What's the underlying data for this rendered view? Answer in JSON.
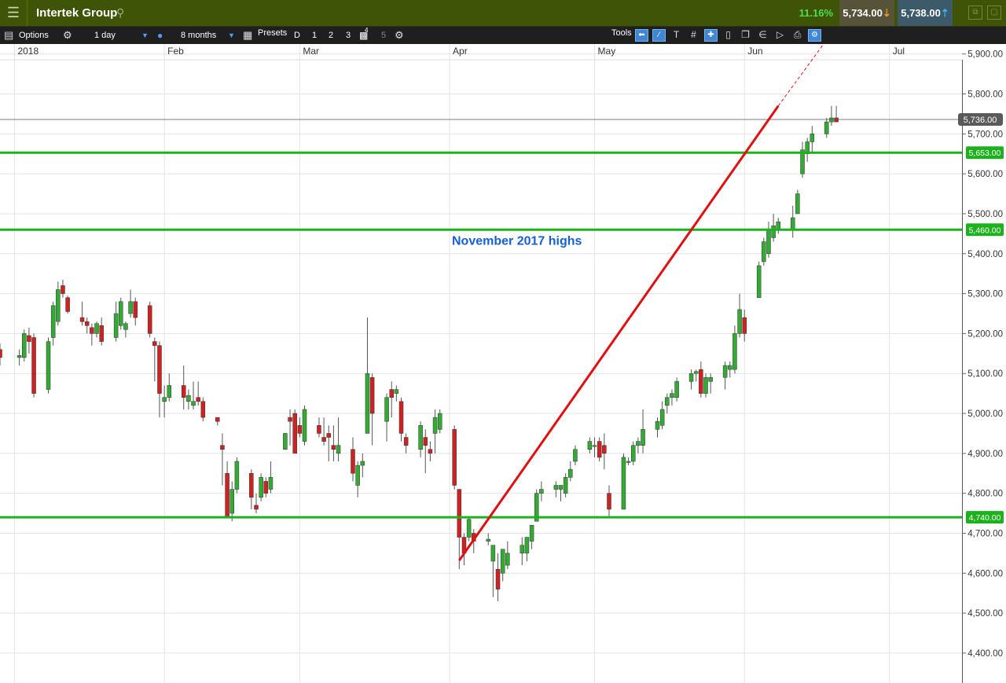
{
  "header": {
    "menu_icon": "menu-icon",
    "instrument": "Intertek Group",
    "search_icon": "search-icon",
    "change_pct": "11.16%",
    "sell_price": "5,734.00",
    "buy_price": "5,738.00"
  },
  "toolbar": {
    "options_label": "Options",
    "interval": "1 day",
    "period": "8 months",
    "presets_label": "Presets",
    "preset_buttons": [
      "D",
      "1",
      "2",
      "3",
      "4",
      "5"
    ],
    "tools_label": "Tools"
  },
  "colors": {
    "up_candle": "#33aa33",
    "down_candle": "#cc2222",
    "level_line": "#1db21d",
    "trend_line": "#e01010",
    "annotation_text": "#1560d6"
  },
  "chart_data": {
    "type": "candlestick",
    "title": "",
    "x_axis": {
      "labels": [
        "2018",
        "Feb",
        "Mar",
        "Apr",
        "May",
        "Jun",
        "Jul"
      ],
      "range": [
        "2017-12-29",
        "2018-07-16"
      ]
    },
    "y_axis": {
      "tick_labels": [
        "4,400.00",
        "4,500.00",
        "4,600.00",
        "4,700.00",
        "4,800.00",
        "4,900.00",
        "5,000.00",
        "5,100.00",
        "5,200.00",
        "5,300.00",
        "5,400.00",
        "5,500.00",
        "5,600.00",
        "5,700.00",
        "5,800.00",
        "5,900.00"
      ],
      "range": [
        4325,
        5925
      ],
      "position": "right"
    },
    "grid": true,
    "current_price": {
      "value": 5736,
      "label": "5,736.00"
    },
    "levels": [
      {
        "value": 5653,
        "label": "5,653.00"
      },
      {
        "value": 5460,
        "label": "5,460.00"
      },
      {
        "value": 4740,
        "label": "4,740.00"
      }
    ],
    "annotations": [
      {
        "text": "November 2017 highs",
        "level": 5460
      }
    ],
    "trend_line": {
      "from": {
        "date": "2018-04-03",
        "price": 4632
      },
      "to": {
        "date": "2018-06-08",
        "price": 5770
      },
      "extended_to": {
        "date": "2018-06-21",
        "price": 5985
      }
    },
    "candles": [
      [
        "2017-12-28",
        5170,
        5210,
        5130,
        5160
      ],
      [
        "2017-12-29",
        5160,
        5175,
        5120,
        5140
      ],
      [
        "2018-01-02",
        5140,
        5160,
        5120,
        5145
      ],
      [
        "2018-01-03",
        5140,
        5210,
        5130,
        5200
      ],
      [
        "2018-01-04",
        5195,
        5215,
        5150,
        5180
      ],
      [
        "2018-01-05",
        5190,
        5200,
        5040,
        5050
      ],
      [
        "2018-01-08",
        5060,
        5190,
        5050,
        5180
      ],
      [
        "2018-01-09",
        5190,
        5280,
        5170,
        5270
      ],
      [
        "2018-01-10",
        5230,
        5330,
        5220,
        5310
      ],
      [
        "2018-01-11",
        5320,
        5335,
        5290,
        5300
      ],
      [
        "2018-01-12",
        5290,
        5295,
        5250,
        5255
      ],
      [
        "2018-01-15",
        5240,
        5280,
        5220,
        5230
      ],
      [
        "2018-01-16",
        5230,
        5240,
        5200,
        5220
      ],
      [
        "2018-01-17",
        5215,
        5225,
        5170,
        5200
      ],
      [
        "2018-01-18",
        5200,
        5230,
        5190,
        5225
      ],
      [
        "2018-01-19",
        5220,
        5240,
        5170,
        5180
      ],
      [
        "2018-01-22",
        5190,
        5280,
        5180,
        5250
      ],
      [
        "2018-01-23",
        5220,
        5290,
        5210,
        5280
      ],
      [
        "2018-01-24",
        5210,
        5230,
        5190,
        5225
      ],
      [
        "2018-01-25",
        5250,
        5310,
        5240,
        5280
      ],
      [
        "2018-01-26",
        5280,
        5290,
        5220,
        5240
      ],
      [
        "2018-01-29",
        5270,
        5280,
        5190,
        5200
      ],
      [
        "2018-01-30",
        5180,
        5190,
        5080,
        5170
      ],
      [
        "2018-01-31",
        5170,
        5180,
        4990,
        5050
      ],
      [
        "2018-02-01",
        5030,
        5070,
        4990,
        5040
      ],
      [
        "2018-02-02",
        5040,
        5100,
        5030,
        5070
      ],
      [
        "2018-02-05",
        5070,
        5120,
        5010,
        5040
      ],
      [
        "2018-02-06",
        5030,
        5060,
        5010,
        5045
      ],
      [
        "2018-02-07",
        5020,
        5080,
        5010,
        5030
      ],
      [
        "2018-02-08",
        5040,
        5080,
        5020,
        5030
      ],
      [
        "2018-02-09",
        5030,
        5040,
        4980,
        4990
      ],
      [
        "2018-02-12",
        4990,
        4990,
        4970,
        4980
      ],
      [
        "2018-02-13",
        4920,
        4950,
        4820,
        4910
      ],
      [
        "2018-02-14",
        4850,
        4880,
        4740,
        4740
      ],
      [
        "2018-02-15",
        4750,
        4830,
        4730,
        4810
      ],
      [
        "2018-02-16",
        4810,
        4890,
        4800,
        4880
      ],
      [
        "2018-02-19",
        4850,
        4860,
        4760,
        4790
      ],
      [
        "2018-02-20",
        4770,
        4800,
        4750,
        4760
      ],
      [
        "2018-02-21",
        4790,
        4850,
        4780,
        4840
      ],
      [
        "2018-02-22",
        4830,
        4840,
        4790,
        4800
      ],
      [
        "2018-02-23",
        4810,
        4880,
        4800,
        4840
      ],
      [
        "2018-02-26",
        4910,
        4950,
        4910,
        4950
      ],
      [
        "2018-02-27",
        4990,
        5010,
        4920,
        4980
      ],
      [
        "2018-02-28",
        5000,
        5010,
        4900,
        4900
      ],
      [
        "2018-03-01",
        4970,
        4990,
        4940,
        4950
      ],
      [
        "2018-03-02",
        4930,
        5020,
        4920,
        5010
      ],
      [
        "2018-03-05",
        4970,
        4990,
        4940,
        4950
      ],
      [
        "2018-03-06",
        4940,
        4990,
        4920,
        4930
      ],
      [
        "2018-03-07",
        4950,
        4970,
        4880,
        4940
      ],
      [
        "2018-03-08",
        4920,
        4970,
        4880,
        4910
      ],
      [
        "2018-03-09",
        4900,
        4990,
        4880,
        4920
      ],
      [
        "2018-03-12",
        4910,
        4940,
        4830,
        4850
      ],
      [
        "2018-03-13",
        4820,
        4880,
        4790,
        4870
      ],
      [
        "2018-03-14",
        4870,
        4900,
        4840,
        4880
      ],
      [
        "2018-03-15",
        4950,
        5240,
        4950,
        5100
      ],
      [
        "2018-03-16",
        5090,
        5100,
        4920,
        5000
      ],
      [
        "2018-03-19",
        4980,
        5050,
        4930,
        5040
      ],
      [
        "2018-03-20",
        5060,
        5080,
        4990,
        5040
      ],
      [
        "2018-03-21",
        5050,
        5070,
        5030,
        5060
      ],
      [
        "2018-03-22",
        5030,
        5040,
        4930,
        4950
      ],
      [
        "2018-03-23",
        4940,
        4950,
        4900,
        4920
      ],
      [
        "2018-03-26",
        4910,
        4980,
        4890,
        4970
      ],
      [
        "2018-03-27",
        4940,
        4960,
        4850,
        4920
      ],
      [
        "2018-03-28",
        4910,
        4930,
        4880,
        4900
      ],
      [
        "2018-03-29",
        4950,
        5010,
        4900,
        4990
      ],
      [
        "2018-03-30",
        4960,
        5010,
        4950,
        5000
      ],
      [
        "2018-04-02",
        4960,
        4970,
        4810,
        4820
      ],
      [
        "2018-04-03",
        4810,
        4800,
        4610,
        4690
      ],
      [
        "2018-04-04",
        4690,
        4700,
        4620,
        4650
      ],
      [
        "2018-04-05",
        4690,
        4740,
        4680,
        4735
      ],
      [
        "2018-04-06",
        4700,
        4710,
        4650,
        4680
      ],
      [
        "2018-04-09",
        4680,
        4700,
        4670,
        4685
      ],
      [
        "2018-04-10",
        4630,
        4660,
        4540,
        4670
      ],
      [
        "2018-04-11",
        4610,
        4650,
        4530,
        4560
      ],
      [
        "2018-04-12",
        4600,
        4660,
        4580,
        4660
      ],
      [
        "2018-04-13",
        4620,
        4680,
        4610,
        4650
      ],
      [
        "2018-04-16",
        4650,
        4690,
        4620,
        4670
      ],
      [
        "2018-04-17",
        4650,
        4690,
        4630,
        4690
      ],
      [
        "2018-04-18",
        4680,
        4720,
        4660,
        4720
      ],
      [
        "2018-04-19",
        4730,
        4810,
        4730,
        4800
      ],
      [
        "2018-04-20",
        4800,
        4830,
        4780,
        4810
      ],
      [
        "2018-04-23",
        4810,
        4830,
        4790,
        4820
      ],
      [
        "2018-04-24",
        4810,
        4820,
        4780,
        4820
      ],
      [
        "2018-04-25",
        4800,
        4850,
        4790,
        4840
      ],
      [
        "2018-04-26",
        4840,
        4880,
        4830,
        4860
      ],
      [
        "2018-04-27",
        4880,
        4920,
        4870,
        4910
      ],
      [
        "2018-04-30",
        4910,
        4940,
        4900,
        4930
      ],
      [
        "2018-05-01",
        4920,
        4940,
        4890,
        4920
      ],
      [
        "2018-05-02",
        4930,
        4940,
        4880,
        4890
      ],
      [
        "2018-05-03",
        4920,
        4950,
        4860,
        4900
      ],
      [
        "2018-05-04",
        4800,
        4820,
        4740,
        4760
      ],
      [
        "2018-05-07",
        4760,
        4900,
        4760,
        4890
      ],
      [
        "2018-05-08",
        4880,
        4890,
        4870,
        4880
      ],
      [
        "2018-05-09",
        4880,
        4930,
        4870,
        4920
      ],
      [
        "2018-05-10",
        4920,
        4940,
        4900,
        4930
      ],
      [
        "2018-05-11",
        4920,
        5010,
        4900,
        4960
      ],
      [
        "2018-05-14",
        4960,
        4990,
        4940,
        4980
      ],
      [
        "2018-05-15",
        4970,
        5030,
        4960,
        5010
      ],
      [
        "2018-05-16",
        5020,
        5050,
        5000,
        5040
      ],
      [
        "2018-05-17",
        5040,
        5060,
        5020,
        5050
      ],
      [
        "2018-05-18",
        5040,
        5090,
        5030,
        5080
      ],
      [
        "2018-05-21",
        5080,
        5110,
        5060,
        5100
      ],
      [
        "2018-05-22",
        5100,
        5110,
        5080,
        5105
      ],
      [
        "2018-05-23",
        5110,
        5130,
        5040,
        5050
      ],
      [
        "2018-05-24",
        5050,
        5100,
        5040,
        5090
      ],
      [
        "2018-05-25",
        5080,
        5100,
        5050,
        5090
      ],
      [
        "2018-05-28",
        5090,
        5130,
        5060,
        5120
      ],
      [
        "2018-05-29",
        5110,
        5130,
        5090,
        5120
      ],
      [
        "2018-05-30",
        5110,
        5220,
        5100,
        5200
      ],
      [
        "2018-05-31",
        5200,
        5300,
        5190,
        5260
      ],
      [
        "2018-06-01",
        5240,
        5260,
        5180,
        5200
      ],
      [
        "2018-06-04",
        5290,
        5380,
        5290,
        5370
      ],
      [
        "2018-06-05",
        5380,
        5440,
        5370,
        5430
      ],
      [
        "2018-06-06",
        5400,
        5480,
        5390,
        5460
      ],
      [
        "2018-06-07",
        5440,
        5500,
        5430,
        5470
      ],
      [
        "2018-06-08",
        5460,
        5490,
        5450,
        5480
      ],
      [
        "2018-06-11",
        5460,
        5520,
        5440,
        5490
      ],
      [
        "2018-06-12",
        5500,
        5560,
        5500,
        5550
      ],
      [
        "2018-06-13",
        5600,
        5680,
        5590,
        5660
      ],
      [
        "2018-06-14",
        5650,
        5690,
        5630,
        5680
      ],
      [
        "2018-06-15",
        5680,
        5720,
        5650,
        5700
      ],
      [
        "2018-06-18",
        5700,
        5740,
        5690,
        5730
      ],
      [
        "2018-06-19",
        5730,
        5770,
        5720,
        5740
      ],
      [
        "2018-06-20",
        5740,
        5770,
        5730,
        5730
      ]
    ]
  }
}
